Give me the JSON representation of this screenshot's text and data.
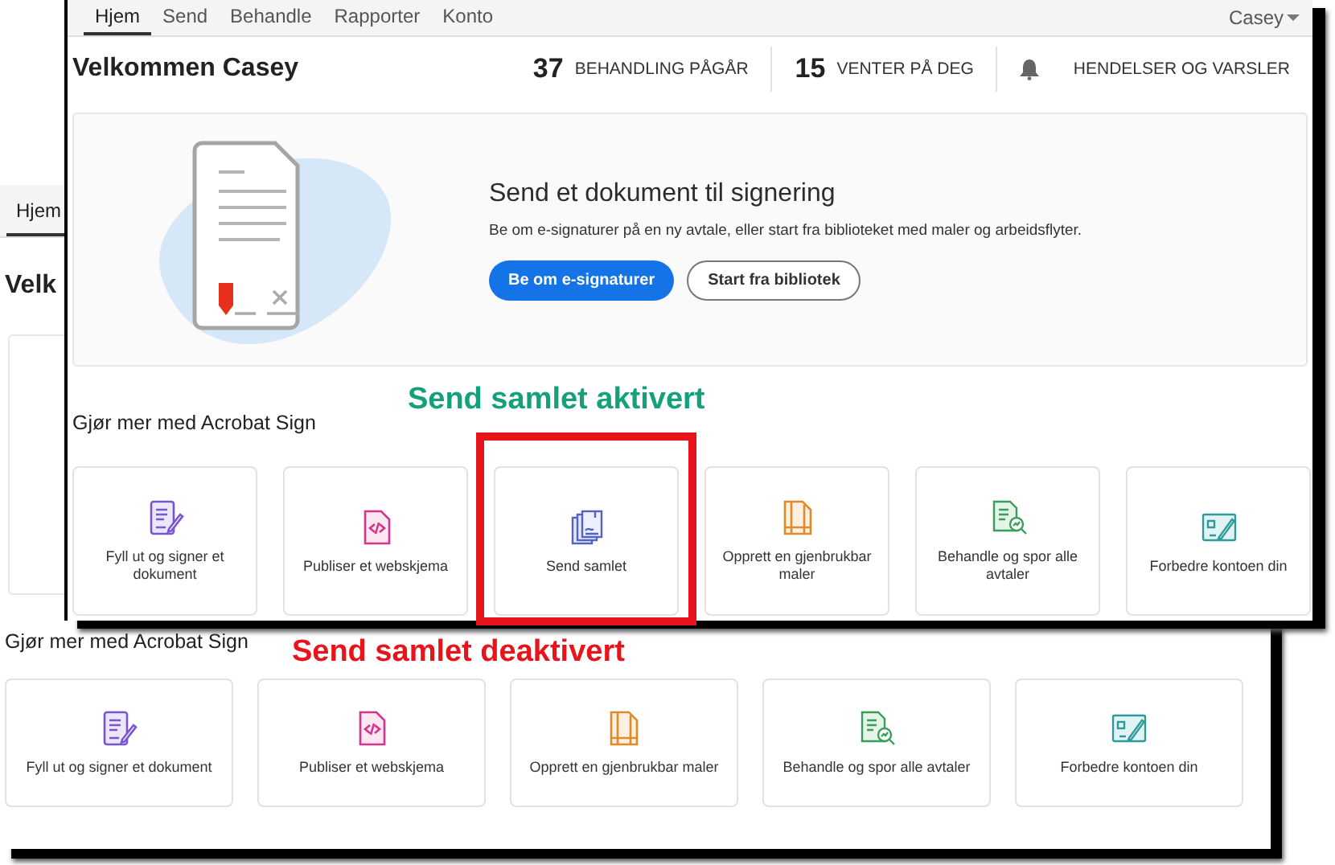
{
  "back_window": {
    "tabs": [
      {
        "label": "Hjem",
        "selected": true
      }
    ],
    "welcome": "Velk",
    "section_title": "Gjør mer med Acrobat Sign",
    "annotation": {
      "text": "Send samlet deaktivert",
      "kind": "disabled"
    },
    "tiles": [
      {
        "label": "Fyll ut og signer et dokument",
        "kind": "fill-sign",
        "highlighted": false
      },
      {
        "label": "Publiser et webskjema",
        "kind": "web-form",
        "highlighted": false
      },
      {
        "label": "Opprett en gjenbrukbar maler",
        "kind": "template",
        "highlighted": false
      },
      {
        "label": "Behandle og spor alle avtaler",
        "kind": "track",
        "highlighted": false
      },
      {
        "label": "Forbedre kontoen din",
        "kind": "account",
        "highlighted": false
      }
    ]
  },
  "front_window": {
    "nav": {
      "tabs": [
        {
          "label": "Hjem",
          "selected": true
        },
        {
          "label": "Send",
          "selected": false
        },
        {
          "label": "Behandle",
          "selected": false
        },
        {
          "label": "Rapporter",
          "selected": false
        },
        {
          "label": "Konto",
          "selected": false
        }
      ],
      "user": "Casey"
    },
    "welcome": "Velkommen Casey",
    "stats": [
      {
        "kind": "count",
        "count": "37",
        "label": "BEHANDLING PÅGÅR"
      },
      {
        "kind": "count",
        "count": "15",
        "label": "VENTER PÅ DEG"
      },
      {
        "kind": "alerts",
        "label": "HENDELSER OG VARSLER"
      }
    ],
    "hero": {
      "title": "Send et dokument til signering",
      "description": "Be om e-signaturer på en ny avtale, eller start fra biblioteket med maler og arbeidsflyter.",
      "buttons": [
        {
          "label": "Be om e-signaturer",
          "kind": "primary"
        },
        {
          "label": "Start fra bibliotek",
          "kind": "secondary"
        }
      ]
    },
    "section_title": "Gjør mer med Acrobat Sign",
    "annotation": {
      "text": "Send samlet aktivert",
      "kind": "enabled"
    },
    "tiles": [
      {
        "label": "Fyll ut og signer et dokument",
        "kind": "fill-sign",
        "highlighted": false
      },
      {
        "label": "Publiser et webskjema",
        "kind": "web-form",
        "highlighted": false
      },
      {
        "label": "Send samlet",
        "kind": "bundle",
        "highlighted": true
      },
      {
        "label": "Opprett en gjenbrukbar maler",
        "kind": "template",
        "highlighted": false
      },
      {
        "label": "Behandle og spor alle avtaler",
        "kind": "track",
        "highlighted": false
      },
      {
        "label": "Forbedre kontoen din",
        "kind": "account",
        "highlighted": false
      }
    ]
  }
}
